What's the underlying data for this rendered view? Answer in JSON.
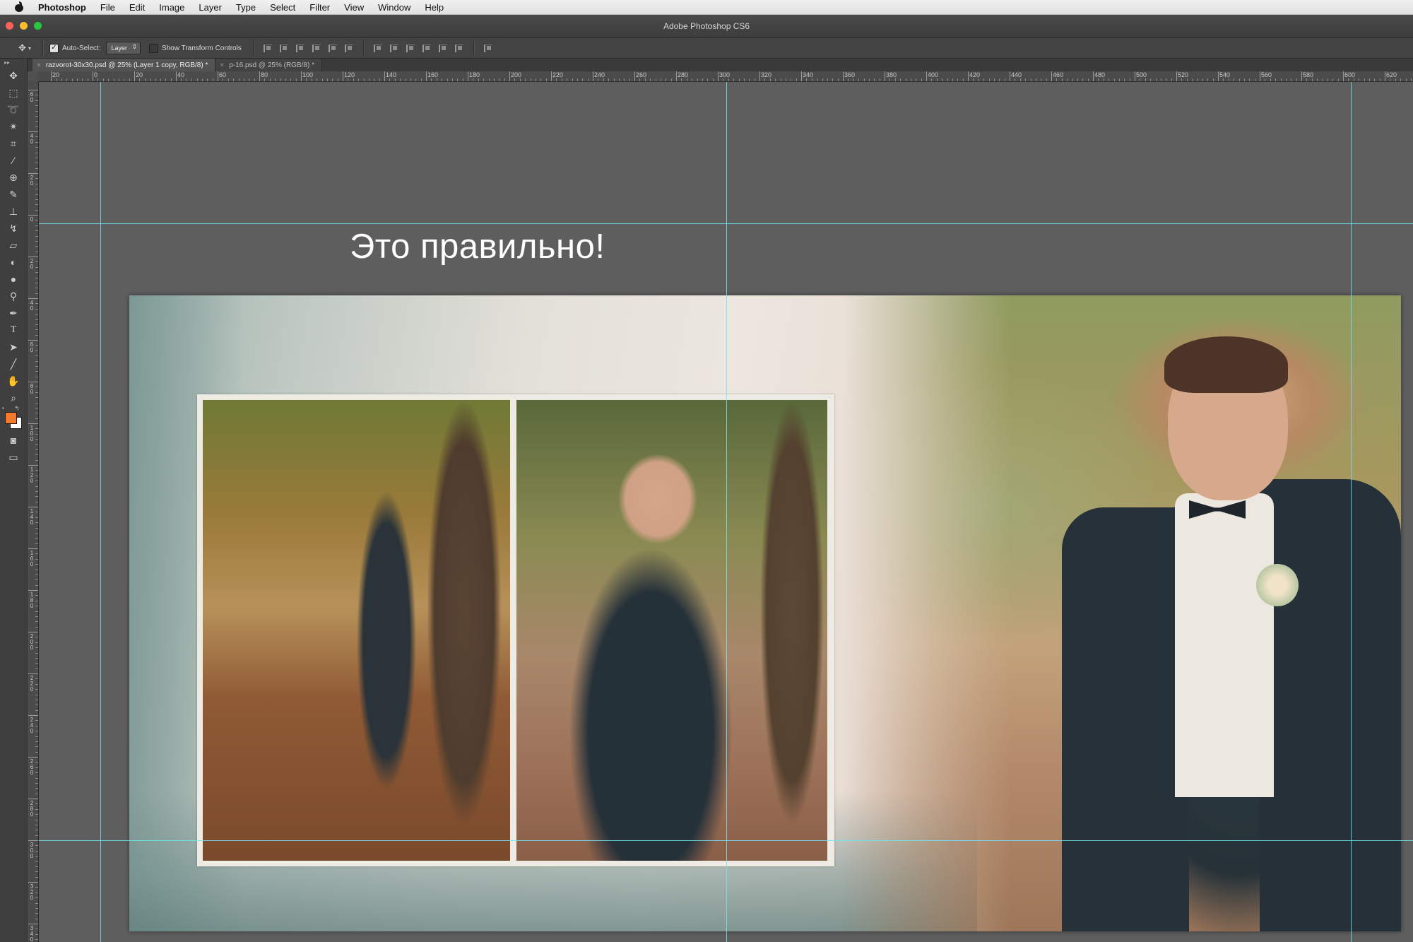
{
  "menubar": {
    "app_name": "Photoshop",
    "items": [
      "File",
      "Edit",
      "Image",
      "Layer",
      "Type",
      "Select",
      "Filter",
      "View",
      "Window",
      "Help"
    ]
  },
  "window": {
    "title": "Adobe Photoshop CS6"
  },
  "options_bar": {
    "auto_select_label": "Auto-Select:",
    "auto_select_checked": true,
    "auto_select_target": "Layer",
    "show_transform_label": "Show Transform Controls",
    "show_transform_checked": false
  },
  "tabs": [
    {
      "label": "razvorot-30x30.psd @ 25% (Layer 1 copy, RGB/8) *",
      "active": true
    },
    {
      "label": "p-16.psd @ 25% (RGB/8) *",
      "active": false
    }
  ],
  "ruler": {
    "horizontal_labels": [
      "20",
      "0",
      "20",
      "40",
      "60",
      "80",
      "100",
      "120",
      "140",
      "160",
      "180",
      "200",
      "220",
      "240",
      "260",
      "280",
      "300",
      "320",
      "340",
      "360",
      "380",
      "400",
      "420",
      "440",
      "460",
      "480",
      "500",
      "520",
      "540",
      "560",
      "580",
      "600",
      "620"
    ],
    "vertical_labels": [
      "60",
      "40",
      "20",
      "0",
      "20",
      "40",
      "60",
      "80",
      "100",
      "120",
      "140",
      "160",
      "180",
      "200",
      "220",
      "240",
      "260",
      "280",
      "300",
      "320",
      "340"
    ]
  },
  "tools": {
    "items": [
      "move-tool",
      "marquee-tool",
      "lasso-tool",
      "magic-wand-tool",
      "crop-tool",
      "eyedropper-tool",
      "spot-healing-tool",
      "brush-tool",
      "clone-stamp-tool",
      "history-brush-tool",
      "eraser-tool",
      "gradient-tool",
      "blur-tool",
      "dodge-tool",
      "pen-tool",
      "type-tool",
      "path-selection-tool",
      "line-tool",
      "hand-tool",
      "zoom-tool"
    ],
    "foreground_color": "#f07a2b",
    "background_color": "#ffffff"
  },
  "canvas": {
    "heading": "Это правильно!",
    "guide_color": "#78e1f0"
  }
}
